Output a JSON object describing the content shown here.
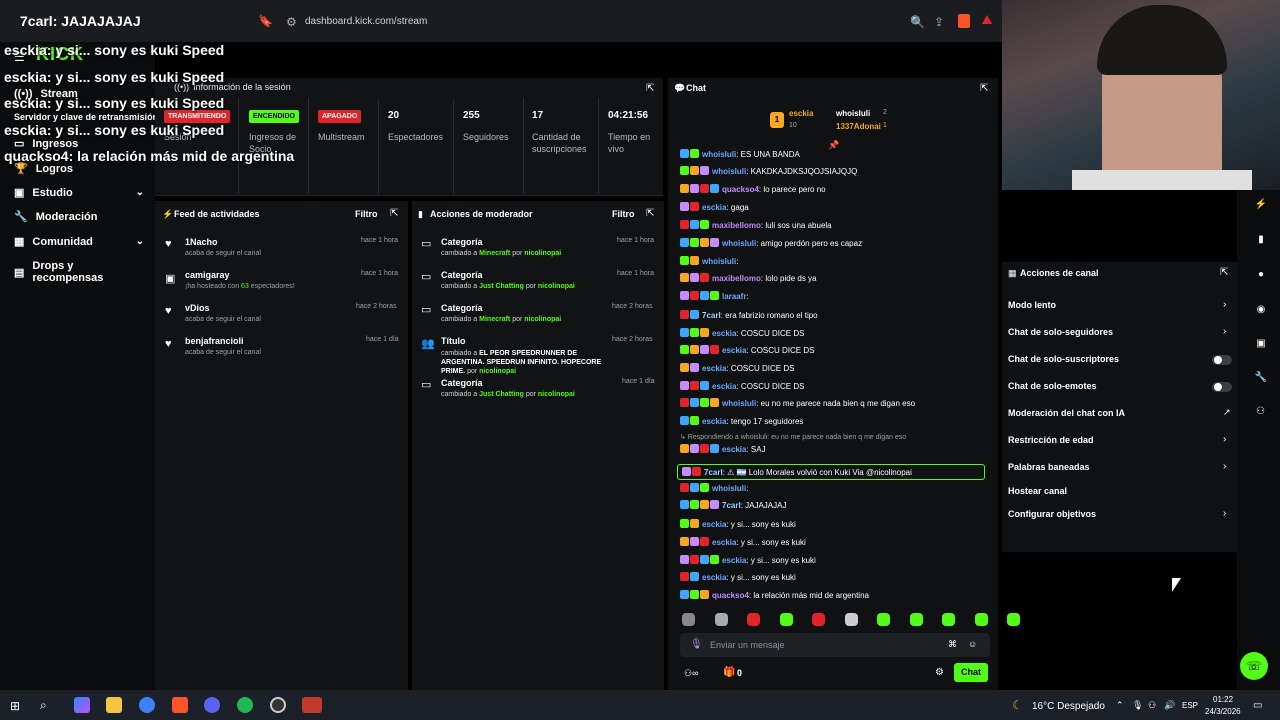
{
  "browser": {
    "tab_title": "7carl: JAJAJAJAJ",
    "url": "dashboard.kick.com/stream"
  },
  "sidebar": {
    "brand": "KICK",
    "items": [
      {
        "label": "Stream",
        "icon": "broadcast-icon"
      },
      {
        "label": "Servidor y clave de retransmisión",
        "icon": "key-icon"
      },
      {
        "label": "Ingresos",
        "icon": "money-icon"
      },
      {
        "label": "Logros",
        "icon": "trophy-icon"
      },
      {
        "label": "Estudio",
        "icon": "studio-icon",
        "expandable": true
      },
      {
        "label": "Moderación",
        "icon": "wrench-icon"
      },
      {
        "label": "Comunidad",
        "icon": "community-icon",
        "expandable": true
      },
      {
        "label": "Drops y recompensas",
        "icon": "gift-icon"
      }
    ]
  },
  "overlay_chat": [
    {
      "user": "esckia",
      "text": ": y si... sony es kuki Speed"
    },
    {
      "user": "esckia",
      "text": ": y si... sony es kuki Speed"
    },
    {
      "user": "esckia",
      "text": ": y si... sony es kuki Speed"
    },
    {
      "user": "esckia",
      "text": ": y si... sony es kuki Speed"
    },
    {
      "user": "quackso4",
      "text": ": la relación más mid de argentina"
    }
  ],
  "session": {
    "title": "Información de la sesión",
    "stats": [
      {
        "badge": "TRANSMITIENDO",
        "label": "Sesión"
      },
      {
        "badge": "ENCENDIDO",
        "label": "Ingresos de Socio"
      },
      {
        "badge": "APAGADO",
        "label": "Multistream"
      },
      {
        "value": "20",
        "label": "Espectadores"
      },
      {
        "value": "255",
        "label": "Seguidores"
      },
      {
        "value": "17",
        "label": "Cantidad de suscripciones"
      },
      {
        "value": "04:21:56",
        "label": "Tiempo en vivo"
      }
    ]
  },
  "activity_feed": {
    "title": "Feed de actividades",
    "filter": "Filtro",
    "items": [
      {
        "name": "1Nacho",
        "sub": "acaba de seguir el canal",
        "time": "hace 1 hora"
      },
      {
        "name": "camigaray",
        "sub_pre": "¡ha hosteado con ",
        "count": "63",
        "sub_post": " espectadores!",
        "time": "hace 1 hora"
      },
      {
        "name": "vDios",
        "sub": "acaba de seguir el canal",
        "time": "hace 2 horas"
      },
      {
        "name": "benjafrancioli",
        "sub": "acaba de seguir el canal",
        "time": "hace 1 día"
      }
    ]
  },
  "mod_actions": {
    "title": "Acciones de moderador",
    "filter": "Filtro",
    "items": [
      {
        "title": "Categoría",
        "pre": "cambiado a ",
        "value": "Minecraft",
        "mid": " por ",
        "by": "nicolinopai",
        "time": "hace 1 hora"
      },
      {
        "title": "Categoría",
        "pre": "cambiado a ",
        "value": "Just Chatting",
        "mid": " por ",
        "by": "nicolinopai",
        "time": "hace 1 hora"
      },
      {
        "title": "Categoría",
        "pre": "cambiado a ",
        "value": "Minecraft",
        "mid": " por ",
        "by": "nicolinopai",
        "time": "hace 2 horas"
      },
      {
        "title": "Título",
        "pre": "cambiado a ",
        "value": "EL PEOR SPEEDRUNNER DE ARGENTINA. SPEEDRUN INFINITO. HOPECORE PRIME.",
        "mid": " por ",
        "by": "nicolinopai",
        "time": "hace 2 horas"
      },
      {
        "title": "Categoría",
        "pre": "cambiado a ",
        "value": "Just Chatting",
        "mid": " por ",
        "by": "nicolinopai",
        "time": "hace 1 día"
      }
    ]
  },
  "chat": {
    "title": "Chat",
    "top_gifters": [
      {
        "rank": "1",
        "name": "esckia",
        "count": "10"
      },
      {
        "name": "whoisluli",
        "count": "2"
      },
      {
        "name": "1337Adonai",
        "count": "1"
      }
    ],
    "messages": [
      {
        "user": "whoisluli",
        "text": ": ES UNA BANDA",
        "color": "#6ea8ff"
      },
      {
        "user": "whoisluli",
        "text": ": KAKDKAJDKSJQOJSIAJQJQ",
        "color": "#6ea8ff"
      },
      {
        "user": "quackso4",
        "text": ": lo parece pero no",
        "color": "#c48bff"
      },
      {
        "user": "esckia",
        "text": ": gaga",
        "color": "#6ea8ff"
      },
      {
        "user": "maxibellomo",
        "text": ": luli sos una abuela",
        "color": "#c48bff"
      },
      {
        "user": "whoisluli",
        "text": ": amigo perdón pero es capaz",
        "color": "#6ea8ff"
      },
      {
        "user": "whoisluli",
        "text": ":",
        "color": "#6ea8ff"
      },
      {
        "user": "maxibellomo",
        "text": ": lolo pide ds ya",
        "color": "#c48bff"
      },
      {
        "user": "laraafr",
        "text": ":",
        "color": "#6ea8ff"
      },
      {
        "user": "7carl",
        "text": ": era fabrizio romano el tipo",
        "color": "#9ad1ff"
      },
      {
        "user": "esckia",
        "text": ": COSCU DICE DS",
        "color": "#6ea8ff"
      },
      {
        "user": "esckia",
        "text": ": COSCU DICE DS",
        "color": "#6ea8ff"
      },
      {
        "user": "esckia",
        "text": ": COSCU DICE DS",
        "color": "#6ea8ff"
      },
      {
        "user": "esckia",
        "text": ": COSCU DICE DS",
        "color": "#6ea8ff"
      },
      {
        "user": "whoisluli",
        "text": ": eu no me parece nada bien q me digan eso",
        "color": "#6ea8ff"
      },
      {
        "user": "esckia",
        "text": ": tengo 17 seguidores",
        "color": "#6ea8ff"
      },
      {
        "user": "",
        "text": "↳ Respondiendo a whoisluli: eu no me parece nada bien q me digan eso",
        "color": "#9aa2a8"
      },
      {
        "user": "esckia",
        "text": ": SAJ",
        "color": "#6ea8ff"
      },
      {
        "user": "7carl",
        "text": ": ⚠ 🇦🇷 Lolo Morales volvió con Kuki Via @nicolinopai",
        "color": "#9ad1ff"
      },
      {
        "user": "whoisluli",
        "text": ":",
        "color": "#6ea8ff"
      },
      {
        "user": "7carl",
        "text": ": JAJAJAJAJ",
        "color": "#9ad1ff"
      },
      {
        "user": "esckia",
        "text": ": y si... sony es kuki",
        "color": "#6ea8ff"
      },
      {
        "user": "esckia",
        "text": ": y si... sony es kuki",
        "color": "#6ea8ff"
      },
      {
        "user": "esckia",
        "text": ": y si... sony es kuki",
        "color": "#6ea8ff"
      },
      {
        "user": "esckia",
        "text": ": y si... sony es kuki",
        "color": "#6ea8ff"
      },
      {
        "user": "quackso4",
        "text": ": la relación más mid de argentina",
        "color": "#c48bff"
      }
    ],
    "input_placeholder": "Enviar un mensaje",
    "points": "0",
    "send_label": "Chat"
  },
  "channel_actions": {
    "title": "Acciones de canal",
    "items": [
      {
        "label": "Modo lento",
        "control": "chevron"
      },
      {
        "label": "Chat de solo-seguidores",
        "control": "chevron"
      },
      {
        "label": "Chat de solo-suscriptores",
        "control": "toggle"
      },
      {
        "label": "Chat de solo-emotes",
        "control": "toggle"
      },
      {
        "label": "Moderación del chat con IA",
        "control": "external"
      },
      {
        "label": "Restricción de edad",
        "control": "chevron"
      },
      {
        "label": "Palabras baneadas",
        "control": "chevron"
      },
      {
        "label": "Hostear canal",
        "control": "none"
      },
      {
        "label": "Configurar objetivos",
        "control": "chevron"
      }
    ]
  },
  "taskbar": {
    "weather": "16°C  Despejado",
    "lang": "ESP",
    "time": "01:22",
    "date": "24/3/2026"
  },
  "colors": {
    "brand_green": "#53fc18",
    "live_red": "#e0242a",
    "panel_bg": "#111315"
  }
}
